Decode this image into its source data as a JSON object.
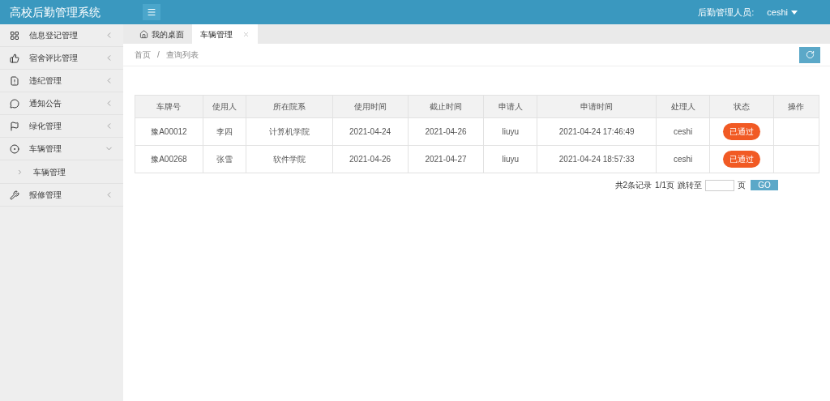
{
  "header": {
    "title": "高校后勤管理系统",
    "user_label": "后勤管理人员:",
    "user_name": "ceshi"
  },
  "sidebar": {
    "items": [
      {
        "label": "信息登记管理",
        "expanded": false
      },
      {
        "label": "宿舍评比管理",
        "expanded": false
      },
      {
        "label": "违纪管理",
        "expanded": false
      },
      {
        "label": "通知公告",
        "expanded": false
      },
      {
        "label": "绿化管理",
        "expanded": false
      },
      {
        "label": "车辆管理",
        "expanded": true,
        "children": [
          {
            "label": "车辆管理"
          }
        ]
      },
      {
        "label": "报修管理",
        "expanded": false
      }
    ]
  },
  "tabs": [
    {
      "label": "我的桌面",
      "selected": false,
      "kind": "home"
    },
    {
      "label": "车辆管理",
      "selected": true,
      "kind": "closable"
    }
  ],
  "breadcrumb": [
    "首页",
    "/",
    "查询列表"
  ],
  "table": {
    "columns": [
      "车牌号",
      "使用人",
      "所在院系",
      "使用时间",
      "截止时间",
      "申请人",
      "申请时间",
      "处理人",
      "状态",
      "操作"
    ],
    "rows": [
      {
        "cells": [
          "豫A00012",
          "李四",
          "计算机学院",
          "2021-04-24",
          "2021-04-26",
          "liuyu",
          "2021-04-24 17:46:49",
          "ceshi"
        ],
        "status": "已通过"
      },
      {
        "cells": [
          "豫A00268",
          "张雪",
          "软件学院",
          "2021-04-26",
          "2021-04-27",
          "liuyu",
          "2021-04-24 18:57:33",
          "ceshi"
        ],
        "status": "已通过"
      }
    ]
  },
  "pagination": {
    "total": "共2条记录",
    "pages": "1/1页",
    "jump_label": "跳转至",
    "page_unit": "页",
    "go": "GO"
  }
}
